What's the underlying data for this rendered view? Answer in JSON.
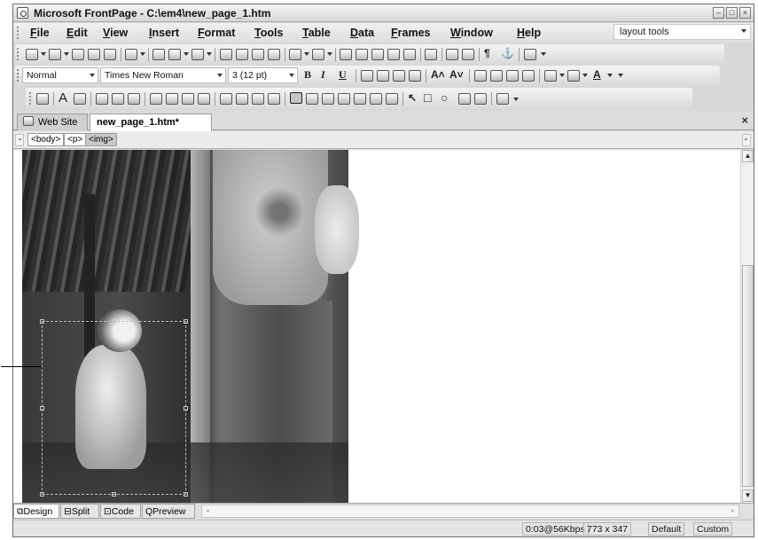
{
  "window": {
    "title": "Microsoft FrontPage - C:\\em4\\new_page_1.htm",
    "controls": {
      "minimize": "–",
      "maximize": "□",
      "close": "×"
    }
  },
  "menubar": {
    "items": [
      "File",
      "Edit",
      "View",
      "Insert",
      "Format",
      "Tools",
      "Table",
      "Data",
      "Frames",
      "Window",
      "Help"
    ],
    "help_box": "layout tools"
  },
  "formatting": {
    "style": "Normal",
    "font": "Times New Roman",
    "size": "3 (12 pt)",
    "bold": "B",
    "italic": "I",
    "underline": "U"
  },
  "tabs": [
    {
      "label": "Web Site"
    },
    {
      "label": "new_page_1.htm*"
    }
  ],
  "tab_close": "×",
  "quick_tags": [
    "<body>",
    "<p>",
    "<img>"
  ],
  "view_tabs": [
    "Design",
    "Split",
    "Code",
    "Preview"
  ],
  "status": {
    "download": "0:03@56Kbps",
    "dimensions": "773 x 347",
    "mode": "Default",
    "css": "Custom"
  },
  "icons": {
    "app": "frontpage-app-icon",
    "website_tab": "website-icon",
    "design_tab": "design-view-icon",
    "split_tab": "split-view-icon",
    "code_tab": "code-view-icon",
    "preview_tab": "preview-view-icon"
  }
}
